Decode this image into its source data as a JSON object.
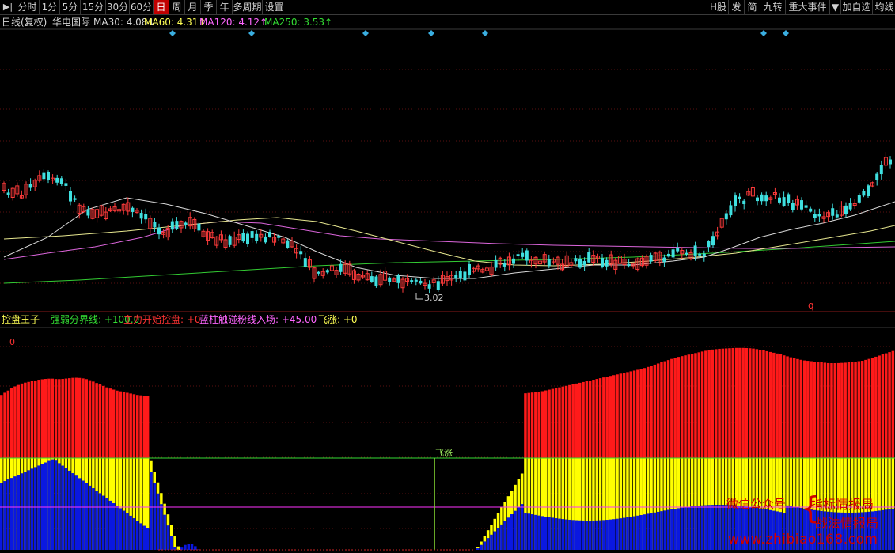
{
  "toolbar": {
    "left_items": [
      "分时",
      "1分",
      "5分",
      "15分",
      "30分",
      "60分",
      "日",
      "周",
      "月",
      "季",
      "年",
      "多周期",
      "设置"
    ],
    "active": "日",
    "right_items": [
      "H股",
      "发",
      "简",
      "九转",
      "重大事件",
      "▼",
      "加自选",
      "均线"
    ]
  },
  "main_panel": {
    "period_label": "日线(复权)",
    "stock_name": "华电国际",
    "ma_labels": [
      {
        "text": "MA30: 4.08↓",
        "color": "#d8d8d8"
      },
      {
        "text": "MA60: 4.31↑",
        "color": "#ffff55"
      },
      {
        "text": "MA120: 4.12↑",
        "color": "#ff66ff"
      },
      {
        "text": "MA250: 3.53↑",
        "color": "#33dd33"
      }
    ],
    "low_label": "3.02",
    "q_marker": "q",
    "colors": {
      "up": "#ff3b3b",
      "down": "#3fe0e0",
      "ma30": "#d8d8d8",
      "ma60": "#e8e890",
      "ma120": "#dd66dd",
      "ma250": "#33cc33",
      "diamond": "#3aaee0"
    }
  },
  "indicator_panel": {
    "labels": [
      {
        "text": "控盘王子",
        "color": "#ffff55"
      },
      {
        "text": "强弱分界线: +100.0",
        "color": "#33dd33"
      },
      {
        "text": "主力开始控盘: +0",
        "color": "#ff3333"
      },
      {
        "text": "蓝柱触碰粉线入场: +45.00",
        "color": "#ff66ff"
      },
      {
        "text": "飞涨: +0",
        "color": "#ffff55"
      }
    ],
    "zero_label": "0",
    "feizhang_label": "飞涨",
    "colors": {
      "red": "#ff1a1a",
      "yellow": "#ffff00",
      "blue": "#0a18e0",
      "threshold": "#33dd33",
      "pink": "#ff33ff"
    }
  },
  "watermark": {
    "line1": "微信公众号",
    "line2": "指标情报局",
    "line3": "战法情报局",
    "url": "www.zhibiao168.com",
    "brace": "{"
  },
  "chart_data": {
    "type": "candlestick+bar",
    "indicator": {
      "red_top_start": [
        140,
        146,
        152,
        158,
        162,
        166,
        168,
        170,
        172,
        174,
        175,
        176,
        176,
        175,
        175,
        176,
        177,
        178,
        178,
        177,
        175,
        172,
        168,
        164,
        160,
        156,
        153,
        150,
        148,
        146,
        144,
        142,
        140,
        139,
        138,
        136
      ],
      "red_top_end": [
        136,
        138,
        140,
        144,
        148,
        152,
        156,
        160,
        164,
        168,
        172,
        176,
        180,
        184,
        188,
        194,
        200,
        206,
        212,
        216,
        220,
        224,
        228,
        230,
        231,
        232,
        232,
        231,
        228,
        224,
        220,
        215,
        210,
        206,
        204,
        202,
        200,
        200,
        201,
        203,
        205,
        210,
        216,
        222,
        228
      ],
      "threshold": 100,
      "pink_level": 45
    }
  }
}
